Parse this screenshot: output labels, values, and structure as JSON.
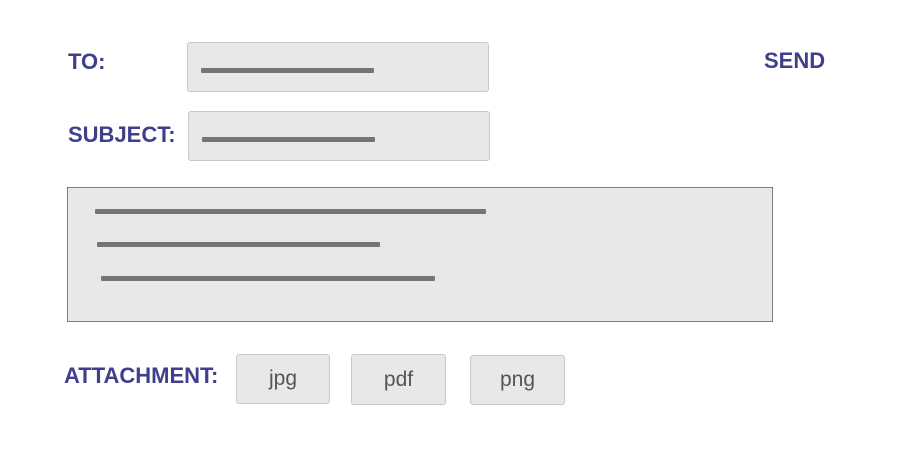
{
  "form": {
    "to_label": "TO:",
    "subject_label": "SUBJECT:",
    "send_label": "SEND",
    "attachment_label": "ATTACHMENT:"
  },
  "attachments": [
    {
      "label": "jpg"
    },
    {
      "label": "pdf"
    },
    {
      "label": "png"
    }
  ],
  "colors": {
    "label_text": "#3f3f8c",
    "field_bg": "#e7e8ea",
    "placeholder_line": "#757575"
  }
}
